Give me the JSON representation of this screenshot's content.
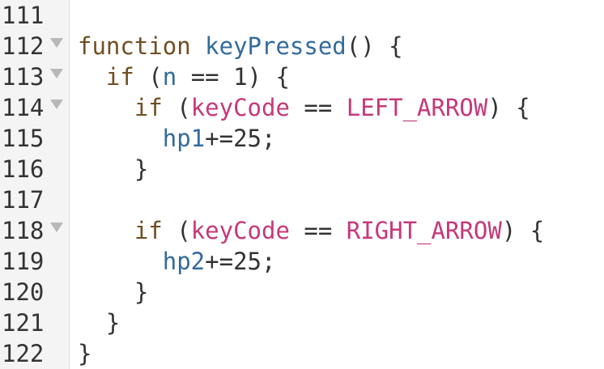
{
  "gutter": {
    "lines": [
      {
        "number": "111",
        "foldable": false
      },
      {
        "number": "112",
        "foldable": true
      },
      {
        "number": "113",
        "foldable": true
      },
      {
        "number": "114",
        "foldable": true
      },
      {
        "number": "115",
        "foldable": false
      },
      {
        "number": "116",
        "foldable": false
      },
      {
        "number": "117",
        "foldable": false
      },
      {
        "number": "118",
        "foldable": true
      },
      {
        "number": "119",
        "foldable": false
      },
      {
        "number": "120",
        "foldable": false
      },
      {
        "number": "121",
        "foldable": false
      },
      {
        "number": "122",
        "foldable": false
      }
    ]
  },
  "code": {
    "line112": {
      "keyword": "function",
      "name": "keyPressed",
      "rest": "() {"
    },
    "line113": {
      "indent": "  ",
      "keyword": "if",
      "open": " (",
      "var": "n",
      "rest": " == 1) {"
    },
    "line114": {
      "indent": "    ",
      "keyword": "if",
      "open": " (",
      "var": "keyCode",
      "op": " == ",
      "const": "LEFT_ARROW",
      "rest": ") {"
    },
    "line115": {
      "indent": "      ",
      "var": "hp1",
      "rest": "+=25;"
    },
    "line116": {
      "text": "    }"
    },
    "line118": {
      "indent": "    ",
      "keyword": "if",
      "open": " (",
      "var": "keyCode",
      "op": " == ",
      "const": "RIGHT_ARROW",
      "rest": ") {"
    },
    "line119": {
      "indent": "      ",
      "var": "hp2",
      "rest": "+=25;"
    },
    "line120": {
      "text": "    }"
    },
    "line121": {
      "text": "  }"
    },
    "line122": {
      "text": "}"
    }
  },
  "colors": {
    "keyword": "#704f21",
    "identifier": "#336b9c",
    "constant": "#c6387a",
    "text": "#333333",
    "gutter_bg": "#f4f4f4",
    "fold_arrow": "#b8b8b8"
  }
}
